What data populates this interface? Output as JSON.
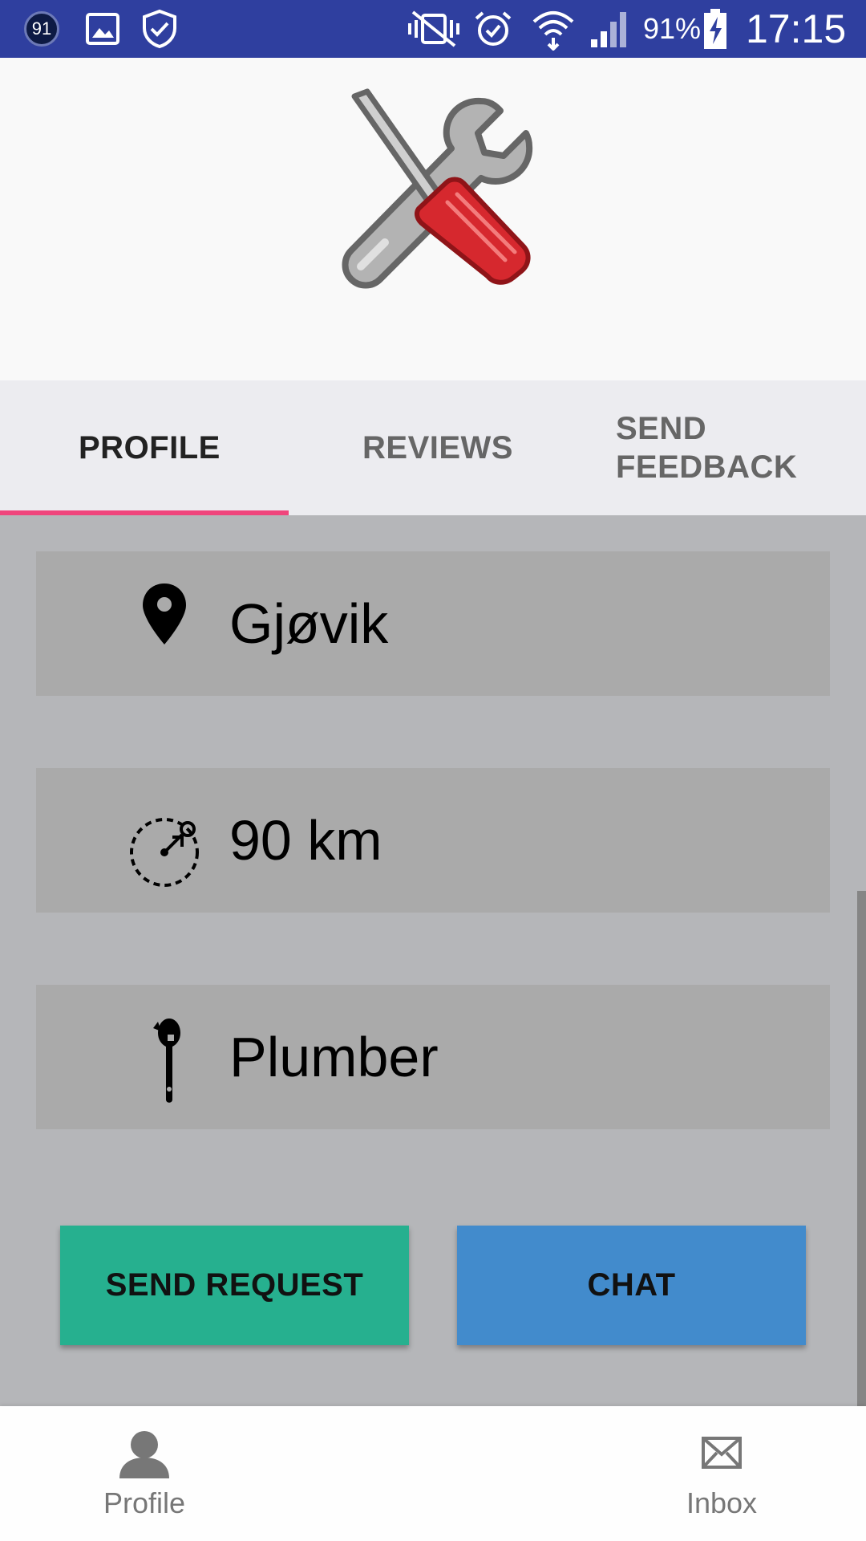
{
  "status_bar": {
    "notification_badge": "91",
    "battery": "91%",
    "time": "17:15",
    "icons": [
      "notification-badge-icon",
      "gallery-icon",
      "shield-check-icon",
      "vibrate-mute-icon",
      "alarm-icon",
      "wifi-icon",
      "signal-icon",
      "battery-charging-icon"
    ]
  },
  "header": {
    "logo_icon": "tools-wrench-screwdriver-icon"
  },
  "tabs": [
    {
      "label": "PROFILE",
      "active": true
    },
    {
      "label": "REVIEWS",
      "active": false
    },
    {
      "label": "SEND\nFEEDBACK",
      "active": false
    }
  ],
  "accent_color": "#f0457c",
  "profile": {
    "location": {
      "icon": "location-pin-icon",
      "value": "Gjøvik"
    },
    "radius": {
      "icon": "radius-icon",
      "value": "90 km"
    },
    "profession": {
      "icon": "wrench-icon",
      "value": "Plumber"
    }
  },
  "actions": {
    "send_request": {
      "label": "SEND REQUEST",
      "color": "#26b08f"
    },
    "chat": {
      "label": "CHAT",
      "color": "#428bcc"
    }
  },
  "bottom_nav": [
    {
      "label": "Profile",
      "icon": "person-icon"
    },
    {
      "label": "Inbox",
      "icon": "envelope-icon"
    }
  ]
}
